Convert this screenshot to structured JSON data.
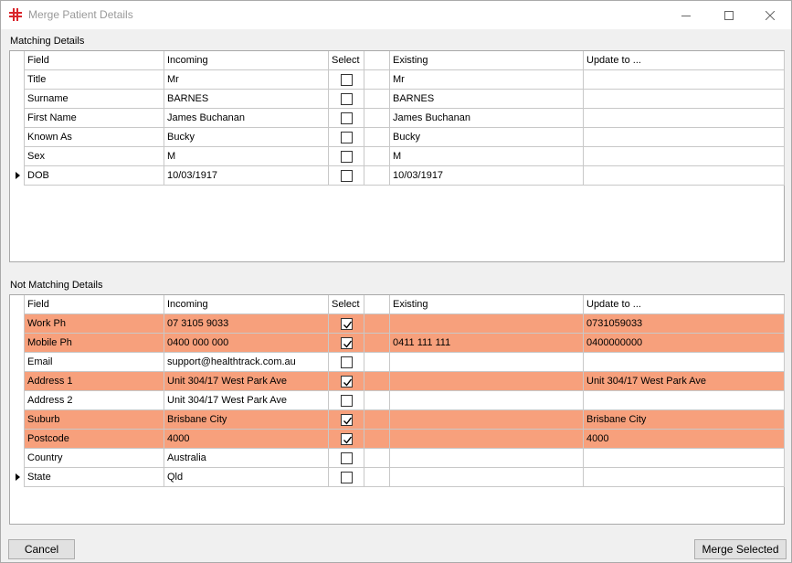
{
  "window": {
    "title": "Merge Patient Details",
    "app_icon_color": "#d9252b"
  },
  "matching": {
    "label": "Matching Details",
    "columns": [
      "Field",
      "Incoming",
      "Select",
      "",
      "Existing",
      "Update to ..."
    ],
    "rows": [
      {
        "field": "Title",
        "incoming": "Mr",
        "selected": false,
        "existing": "Mr",
        "update": ""
      },
      {
        "field": "Surname",
        "incoming": "BARNES",
        "selected": false,
        "existing": "BARNES",
        "update": ""
      },
      {
        "field": "First Name",
        "incoming": "James Buchanan",
        "selected": false,
        "existing": "James Buchanan",
        "update": ""
      },
      {
        "field": "Known As",
        "incoming": "Bucky",
        "selected": false,
        "existing": "Bucky",
        "update": ""
      },
      {
        "field": "Sex",
        "incoming": "M",
        "selected": false,
        "existing": "M",
        "update": ""
      },
      {
        "field": "DOB",
        "incoming": "10/03/1917",
        "selected": false,
        "existing": "10/03/1917",
        "update": "",
        "current": true
      }
    ]
  },
  "not_matching": {
    "label": "Not Matching Details",
    "highlight_color": "#f7a07c",
    "columns": [
      "Field",
      "Incoming",
      "Select",
      "",
      "Existing",
      "Update to ..."
    ],
    "rows": [
      {
        "field": "Work Ph",
        "incoming": "07 3105 9033",
        "selected": true,
        "existing": "",
        "update": "0731059033"
      },
      {
        "field": "Mobile Ph",
        "incoming": "0400 000 000",
        "selected": true,
        "existing": "0411 111 111",
        "update": "0400000000"
      },
      {
        "field": "Email",
        "incoming": "support@healthtrack.com.au",
        "selected": false,
        "existing": "",
        "update": ""
      },
      {
        "field": "Address 1",
        "incoming": "Unit 304/17 West Park Ave",
        "selected": true,
        "existing": "",
        "update": "Unit 304/17 West Park Ave"
      },
      {
        "field": "Address 2",
        "incoming": "Unit 304/17 West Park Ave",
        "selected": false,
        "existing": "",
        "update": ""
      },
      {
        "field": "Suburb",
        "incoming": "Brisbane City",
        "selected": true,
        "existing": "",
        "update": "Brisbane City"
      },
      {
        "field": "Postcode",
        "incoming": "4000",
        "selected": true,
        "existing": "",
        "update": "4000"
      },
      {
        "field": "Country",
        "incoming": "Australia",
        "selected": false,
        "existing": "",
        "update": ""
      },
      {
        "field": "State",
        "incoming": "Qld",
        "selected": false,
        "existing": "",
        "update": "",
        "current": true
      }
    ]
  },
  "buttons": {
    "cancel": "Cancel",
    "merge": "Merge Selected"
  }
}
